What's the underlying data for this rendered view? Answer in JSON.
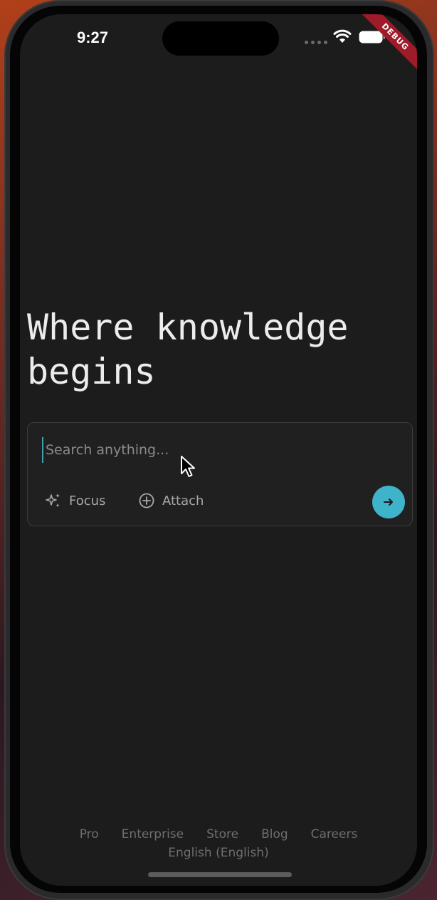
{
  "status_bar": {
    "time": "9:27",
    "debug_label": "DEBUG"
  },
  "hero": {
    "title": "Where knowledge begins"
  },
  "search": {
    "placeholder": "Search anything...",
    "value": "",
    "focus_label": "Focus",
    "attach_label": "Attach",
    "submit_icon": "arrow-right-icon"
  },
  "footer": {
    "links": [
      "Pro",
      "Enterprise",
      "Store",
      "Blog",
      "Careers"
    ],
    "language": "English (English)"
  },
  "colors": {
    "accent": "#3fb3c9",
    "background": "#1c1c1c",
    "debug_banner": "#a01b2a"
  }
}
